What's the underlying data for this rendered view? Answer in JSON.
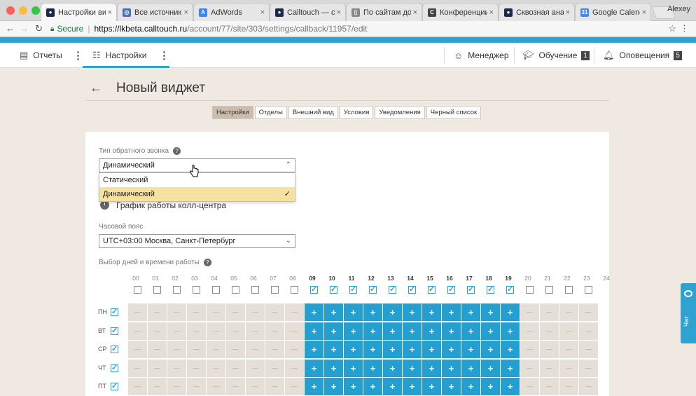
{
  "browser": {
    "tabs": [
      {
        "title": "Настройки ви",
        "color": "#1a2b4a",
        "glyph": "●"
      },
      {
        "title": "Все источник",
        "color": "#4a6fb5",
        "glyph": "◎"
      },
      {
        "title": "AdWords",
        "color": "#3b82f6",
        "glyph": "A"
      },
      {
        "title": "Calltouch — с",
        "color": "#1a2b4a",
        "glyph": "●"
      },
      {
        "title": "По сайтам до",
        "color": "#888888",
        "glyph": "▯"
      },
      {
        "title": "Конференции",
        "color": "#444444",
        "glyph": "C"
      },
      {
        "title": "Сквозная ана",
        "color": "#1a2b4a",
        "glyph": "●"
      },
      {
        "title": "Google Calend",
        "color": "#4285f4",
        "glyph": "31"
      }
    ],
    "user": "Alexey",
    "secure_label": "Secure",
    "url_host": "https://lkbeta.calltouch.ru",
    "url_path": "/account/77/site/303/settings/callback/11957/edit"
  },
  "topnav": {
    "reports": "Отчеты",
    "settings": "Настройки",
    "manager": "Менеджер",
    "training": "Обучение",
    "training_badge": "1",
    "notifications": "Оповещения",
    "notifications_badge": "5"
  },
  "page": {
    "back": "←",
    "title": "Новый виджет"
  },
  "subtabs": [
    "Настройки",
    "Отделы",
    "Внешний вид",
    "Условия",
    "Уведомления",
    "Черный список"
  ],
  "form": {
    "callback_type_label": "Тип обратного звонка",
    "callback_type_value": "Динамический",
    "options": [
      "Статический",
      "Динамический"
    ],
    "selected_option": "Динамический",
    "schedule_title": "График работы колл-центра",
    "timezone_label": "Часовой пояс",
    "timezone_value": "UTC+03:00 Москва, Санкт-Петербург",
    "days_label": "Выбор дней и времени работы"
  },
  "schedule": {
    "hours": [
      "00",
      "01",
      "02",
      "03",
      "04",
      "05",
      "06",
      "07",
      "08",
      "09",
      "10",
      "11",
      "12",
      "13",
      "14",
      "15",
      "16",
      "17",
      "18",
      "19",
      "20",
      "21",
      "22",
      "23",
      "24"
    ],
    "active_hours_from": 9,
    "active_hours_to": 19,
    "days": [
      "ПН",
      "ВТ",
      "СР",
      "ЧТ",
      "ПТ"
    ],
    "on_symbol": "+",
    "off_symbol": "—"
  },
  "chat": {
    "label": "Чат"
  },
  "colors": {
    "accent": "#2ea3d1",
    "cell_on": "#239fd2",
    "cell_off": "#e5dfd8",
    "dropdown_selected": "#f7e1a1"
  }
}
